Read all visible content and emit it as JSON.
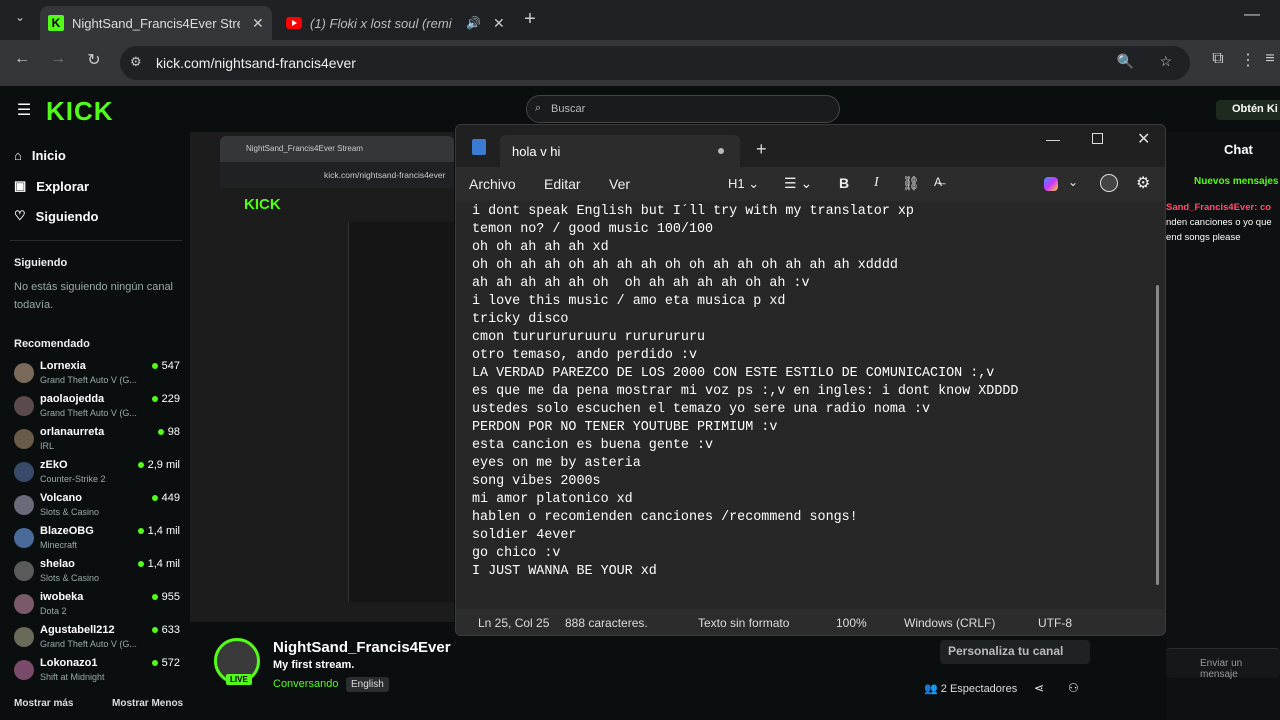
{
  "browser": {
    "tabs": [
      {
        "title": "NightSand_Francis4Ever Stream"
      },
      {
        "title": "(1) Floki x lost soul (remi"
      }
    ],
    "url": "kick.com/nightsand-francis4ever"
  },
  "kick": {
    "logo": "KICK",
    "search_placeholder": "Buscar",
    "get_button": "Obtén Ki",
    "nav": [
      "Inicio",
      "Explorar",
      "Siguiendo"
    ],
    "following_header": "Siguiendo",
    "following_empty": "No estás siguiendo ningún canal todavía.",
    "recommended_header": "Recomendado",
    "recommended": [
      {
        "name": "Lornexia",
        "game": "Grand Theft Auto V (G...",
        "count": "547"
      },
      {
        "name": "paolaojedda",
        "game": "Grand Theft Auto V (G...",
        "count": "229"
      },
      {
        "name": "orlanaurreta",
        "game": "IRL",
        "count": "98"
      },
      {
        "name": "zEkO",
        "game": "Counter-Strike 2",
        "count": "2,9 mil"
      },
      {
        "name": "Volcano",
        "game": "Slots & Casino",
        "count": "449"
      },
      {
        "name": "BlazeOBG",
        "game": "Minecraft",
        "count": "1,4 mil"
      },
      {
        "name": "shelao",
        "game": "Slots & Casino",
        "count": "1,4 mil"
      },
      {
        "name": "iwobeka",
        "game": "Dota 2",
        "count": "955"
      },
      {
        "name": "Agustabell212",
        "game": "Grand Theft Auto V (G...",
        "count": "633"
      },
      {
        "name": "Lokonazo1",
        "game": "Shift at Midnight",
        "count": "572"
      }
    ],
    "show_more": "Mostrar más",
    "show_less": "Mostrar Menos",
    "channel": {
      "name": "NightSand_Francis4Ever",
      "stream_title": "My first stream.",
      "category": "Conversando",
      "language": "English",
      "live": "LIVE",
      "viewers": "2 Espectadores",
      "customize": "Personaliza tu canal"
    },
    "chat": {
      "title": "Chat",
      "new_messages": "Nuevos mensajes",
      "line1": "Sand_Francis4Ever: co",
      "line2": "nden canciones o yo que",
      "line3": "end songs please",
      "input_placeholder": "Enviar un mensaje"
    }
  },
  "notepad": {
    "tab_title": "hola v  hi",
    "menu": [
      "Archivo",
      "Editar",
      "Ver"
    ],
    "heading": "H1",
    "lines": [
      "i dont speak English but I´ll try with my translator xp",
      "temon no? / good music 100/100",
      "oh oh ah ah ah xd",
      "oh oh ah ah oh ah ah ah oh oh ah ah oh ah ah ah xdddd",
      "ah ah ah ah ah oh  oh ah ah ah ah oh ah :v",
      "i love this music / amo eta musica p xd",
      "tricky disco",
      "cmon tururururuuru rururururu",
      "otro temaso, ando perdido :v",
      "LA VERDAD PAREZCO DE LOS 2000 CON ESTE ESTILO DE COMUNICACION :,v",
      "es que me da pena mostrar mi voz ps :,v en ingles: i dont know XDDDD",
      "ustedes solo escuchen el temazo yo sere una radio noma :v",
      "PERDON POR NO TENER YOUTUBE PRIMIUM :v",
      "esta cancion es buena gente :v",
      "eyes on me by asteria",
      "song vibes 2000s",
      "mi amor platonico xd",
      "hablen o recomienden canciones /recommend songs!",
      "soldier 4ever",
      "go chico :v",
      "I JUST WANNA BE YOUR xd "
    ],
    "status": {
      "position": "Ln 25, Col 25",
      "chars": "888 caracteres.",
      "format": "Texto sin formato",
      "zoom": "100%",
      "eol": "Windows (CRLF)",
      "encoding": "UTF-8"
    }
  }
}
